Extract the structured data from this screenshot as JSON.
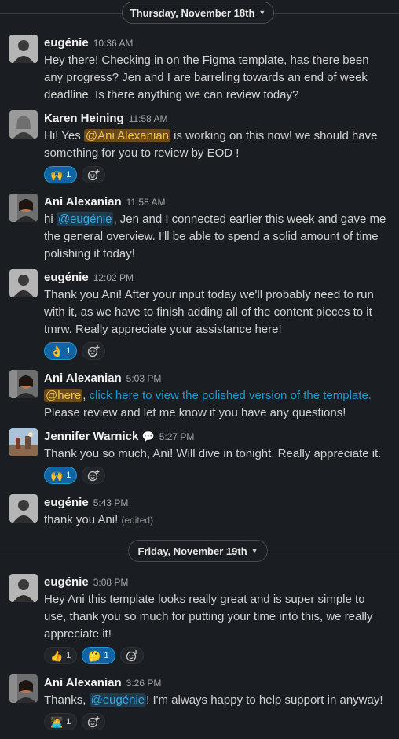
{
  "dividers": [
    {
      "label": "Thursday, November 18th"
    },
    {
      "label": "Friday, November 19th"
    }
  ],
  "messages": [
    {
      "author": "eugénie",
      "time": "10:36 AM",
      "text": "Hey there! Checking in on the Figma template, has there been any progress? Jen and I are barreling towards an end of week deadline. Is there anything we can review today?"
    },
    {
      "author": "Karen Heining",
      "time": "11:58 AM",
      "parts": [
        "Hi! Yes ",
        "@Ani Alexanian",
        " is working on this now! we should have something for you to review by EOD !"
      ],
      "reactions": [
        {
          "emoji": "🙌",
          "count": "1"
        }
      ]
    },
    {
      "author": "Ani Alexanian",
      "time": "11:58 AM",
      "parts": [
        "hi ",
        "@eugénie",
        ", Jen and I connected earlier this week and gave me the general overview. I'll be able to spend a solid amount of time polishing it today!"
      ]
    },
    {
      "author": "eugénie",
      "time": "12:02 PM",
      "text": "Thank you Ani! After your input today we'll probably need to run with it, as we have to finish adding all of the content pieces to it tmrw. Really appreciate your assistance here!",
      "reactions": [
        {
          "emoji": "👌",
          "count": "1"
        }
      ]
    },
    {
      "author": "Ani Alexanian",
      "time": "5:03 PM",
      "parts": [
        "@here",
        ", ",
        "click here to view the polished version of the template.",
        "Please review and let me know if you have any questions!"
      ]
    },
    {
      "author": "Jennifer Warnick",
      "status": "💬",
      "time": "5:27 PM",
      "text": "Thank you so much, Ani! Will dive in tonight. Really appreciate it.",
      "reactions": [
        {
          "emoji": "🙌",
          "count": "1"
        }
      ]
    },
    {
      "author": "eugénie",
      "time": "5:43 PM",
      "text": "thank you Ani!",
      "edited": "(edited)"
    },
    {
      "author": "eugénie",
      "time": "3:08 PM",
      "text": "Hey Ani this template looks really great and is super simple to use, thank you so much for putting your time into this, we really appreciate it!",
      "reactions": [
        {
          "emoji": "👍",
          "count": "1"
        },
        {
          "emoji": "🤔",
          "count": "1"
        }
      ]
    },
    {
      "author": "Ani Alexanian",
      "time": "3:26 PM",
      "parts": [
        "Thanks, ",
        "@eugénie",
        "! I'm always happy to help support in anyway!"
      ],
      "reactions": [
        {
          "emoji": "🧑‍💻",
          "count": "1"
        }
      ]
    }
  ],
  "icons": {
    "add_reaction": "add-reaction-icon",
    "chevron": "chevron-down-icon"
  },
  "colors": {
    "background": "#1a1d21",
    "mention": "#36a9e1",
    "link": "#1d9bd1",
    "reaction_active": "#1164a3"
  }
}
